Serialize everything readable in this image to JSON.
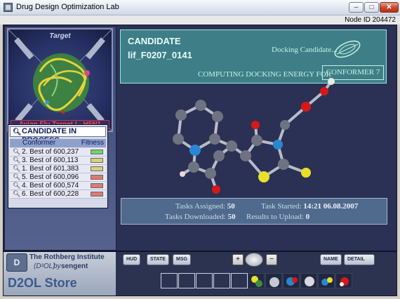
{
  "window": {
    "title": "Drug Design Optimization Lab",
    "minimize": "–",
    "maximize": "□",
    "close": "✕"
  },
  "node": {
    "label": "Node ID 204472"
  },
  "target": {
    "label": "Target",
    "caption": "Avian Flu Target I - H5N1"
  },
  "toolbar_left": [
    {
      "icon": "molecule-icon",
      "glyph": "●"
    },
    {
      "icon": "bonds-icon",
      "glyph": "━"
    },
    {
      "icon": "chart-icon",
      "glyph": "▮▮"
    },
    {
      "icon": "check-icon",
      "glyph": "✓"
    },
    {
      "icon": "help-icon",
      "glyph": "?"
    },
    {
      "icon": "globe-icon",
      "glyph": "◕"
    }
  ],
  "process": {
    "header": "CANDIDATE IN PROCESS",
    "col_conformer": "Conformer",
    "col_fitness": "Fitness",
    "rows": [
      {
        "label": "2.  Best of 600,237",
        "color": "#6fd36b"
      },
      {
        "label": "3.  Best of 600,113",
        "color": "#d8d27a"
      },
      {
        "label": "1.  Best of 601,383",
        "color": "#d8d27a"
      },
      {
        "label": "5.  Best of 600,096",
        "color": "#e07a72"
      },
      {
        "label": "4.  Best of 600,574",
        "color": "#e07a72"
      },
      {
        "label": "6.  Best of 600,228",
        "color": "#e07a72"
      }
    ]
  },
  "candidate": {
    "title": "CANDIDATE",
    "id": "lif_F0207_0141",
    "status": "Docking Candidate...",
    "computing": "COMPUTING DOCKING ENERGY FOR",
    "conformer": "CONFORMER 7"
  },
  "stats": {
    "assigned_label": "Tasks Assigned:",
    "assigned_value": "50",
    "downloaded_label": "Tasks Downloaded:",
    "downloaded_value": "50",
    "started_label": "Task Started:",
    "started_value": "14:21 06.08.2007",
    "upload_label": "Results to Upload:",
    "upload_value": "0"
  },
  "brand": {
    "logo": "D",
    "line1": "The Rothberg Institute",
    "line2": "(D²OL)",
    "line2b": "by",
    "line3": "sengent",
    "store": "D2OL Store"
  },
  "bottom_controls": {
    "hud": "HUD",
    "state": "STATE",
    "msg": "MSG",
    "name": "NAME",
    "detail": "DETAIL"
  }
}
